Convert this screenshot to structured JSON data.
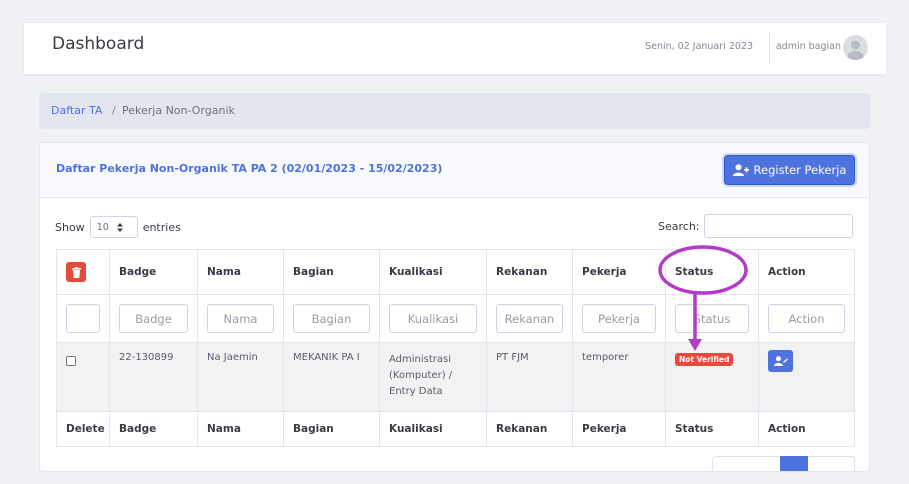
{
  "header": {
    "title": "Dashboard",
    "date": "Senin, 02 Januari 2023",
    "user": "admin bagian",
    "avatar_icon": "user-avatar-icon"
  },
  "breadcrumb": {
    "items": [
      "Daftar TA",
      "Pekerja Non-Organik"
    ],
    "separator": "/"
  },
  "card": {
    "title": "Daftar Pekerja Non-Organik TA PA 2 (02/01/2023 - 15/02/2023)",
    "register_button": "Register Pekerja"
  },
  "controls": {
    "show_label": "Show",
    "entries_value": "10",
    "entries_label": "entries",
    "search_label": "Search:"
  },
  "table": {
    "headers": [
      "Badge",
      "Nama",
      "Bagian",
      "Kualikasi",
      "Rekanan",
      "Pekerja",
      "Status",
      "Action"
    ],
    "filters": [
      "Badge",
      "Nama",
      "Bagian",
      "Kualikasi",
      "Rekanan",
      "Pekerja",
      "Status",
      "Action"
    ],
    "rows": [
      {
        "badge": "22-130899",
        "nama": "Na Jaemin",
        "bagian": "MEKANIK PA I",
        "kualikasi": [
          "Administrasi",
          "(Komputer) /",
          "Entry Data"
        ],
        "rekanan": "PT FJM",
        "pekerja": "temporer",
        "status": "Not Verified"
      }
    ],
    "footer": [
      "Delete",
      "Badge",
      "Nama",
      "Bagian",
      "Kualikasi",
      "Rekanan",
      "Pekerja",
      "Status",
      "Action"
    ]
  },
  "colors": {
    "primary": "#4e73df",
    "danger": "#e74a3b",
    "annotation": "#b33cc7"
  }
}
